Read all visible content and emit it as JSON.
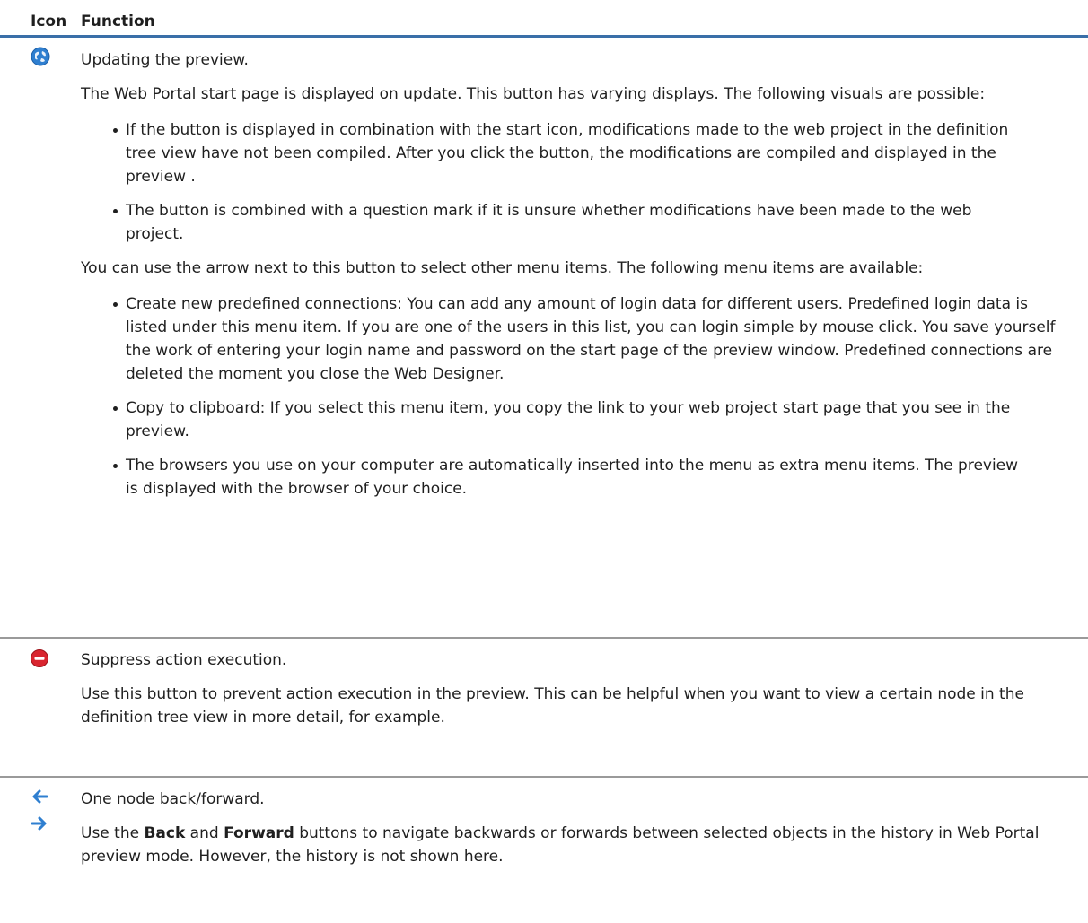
{
  "table": {
    "header": {
      "icon_col": "Icon",
      "function_col": "Function"
    },
    "rows": [
      {
        "icon": "globe-refresh-icon",
        "title": "Updating the preview.",
        "intro": "The Web Portal start page is displayed on update. This button has varying displays. The following visuals are possible:",
        "bullets1": [
          "If the button is displayed in combination with the start icon, modifications made to the web project in the definition tree view have not been compiled. After you click the button, the modifications are compiled and displayed in the preview .",
          "The button is combined with a question mark if it is unsure whether modifications have been made to the web project."
        ],
        "intro2": "You can use the arrow next to this button to select other menu items. The following menu items are available:",
        "bullets2": [
          "Create new predefined connections: You can add any amount of login data for different users. Predefined login data is listed under this menu item. If you are one of the users in this list, you can login simple by mouse click. You save yourself the work of entering your login name and password on the start page of the preview window. Predefined connections are deleted the moment you close the Web Designer.",
          "Copy to clipboard: If you select this menu item, you copy the link to your web project start page that you see in the preview.",
          "The browsers you use on your computer are automatically inserted into the menu as extra menu items. The preview is displayed with the browser of your choice."
        ]
      },
      {
        "icon": "stop-sign-icon",
        "title": "Suppress action execution.",
        "desc": "Use this button to prevent action execution in the preview. This can be helpful when you want to view a certain node in the definition tree view in more detail, for example."
      },
      {
        "icons": [
          "arrow-left-icon",
          "arrow-right-icon"
        ],
        "title": "One node back/forward.",
        "desc_part1": "Use the ",
        "desc_bold1": "Back",
        "desc_part2": " and ",
        "desc_bold2": "Forward",
        "desc_part3": " buttons to navigate backwards or forwards between selected objects in the history in Web Portal preview mode. However, the history is not shown here."
      }
    ]
  },
  "colors": {
    "header_rule": "#3a6fa8",
    "divider": "#9a9a9a",
    "icon_blue": "#2f7fd0",
    "icon_red": "#d9252f"
  }
}
